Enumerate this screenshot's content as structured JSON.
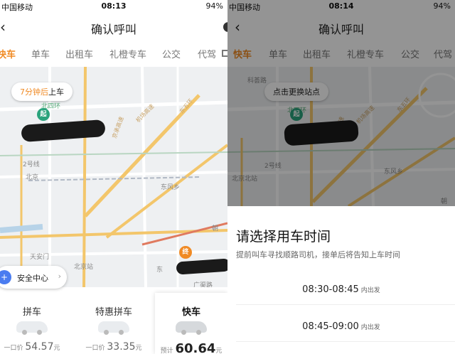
{
  "left": {
    "status": {
      "carrier": "中国移动",
      "time": "08:13",
      "battery": "94%"
    },
    "nav": {
      "title": "确认呼叫"
    },
    "tabs": [
      "快车",
      "单车",
      "出租车",
      "礼橙专车",
      "公交",
      "代驾"
    ],
    "pickup": {
      "minutes": "7分钟后",
      "suffix": "上车"
    },
    "pins": {
      "start": "起",
      "end": "终"
    },
    "map_labels": {
      "ring": "北四环",
      "east_ring": "东五环",
      "beijing": "北京",
      "dongfeng": "东风乡",
      "tiananmen": "天安门",
      "station": "北京站",
      "guangqu": "广渠路",
      "line2": "2号线",
      "dong": "东",
      "chao": "朝",
      "road": "机场高速",
      "road2": "京承高速"
    },
    "safety": {
      "label": "安全中心",
      "icon_text": "+"
    },
    "cards": [
      {
        "name": "拼车",
        "prefix": "一口价",
        "price": "54.57",
        "unit": "元"
      },
      {
        "name": "特惠拼车",
        "prefix": "一口价",
        "price": "33.35",
        "unit": "元"
      },
      {
        "name": "快车",
        "prefix": "预计",
        "price": "60.64",
        "unit": "元"
      }
    ]
  },
  "right": {
    "status": {
      "carrier": "中国移动",
      "time": "08:14",
      "battery": "94%"
    },
    "nav": {
      "title": "确认呼叫"
    },
    "tabs": [
      "快车",
      "单车",
      "出租车",
      "礼橙专车",
      "公交",
      "代驾"
    ],
    "change_stop": "点击更换站点",
    "pins": {
      "start": "起"
    },
    "map_labels": {
      "keyi": "科荟路",
      "ring": "北四环",
      "east_ring": "东五环",
      "station": "北京北站",
      "dongfeng": "东风乡",
      "line2": "2号线",
      "road": "机场高速",
      "road2": "京承高速",
      "chao": "朝"
    },
    "sheet": {
      "title": "请选择用车时间",
      "subtitle": "提前叫车寻找顺路司机，接单后将告知上车时间",
      "slots": [
        {
          "time": "08:30-08:45",
          "suffix": "内出发"
        },
        {
          "time": "08:45-09:00",
          "suffix": "内出发"
        }
      ]
    }
  },
  "colors": {
    "accent": "#f08a24",
    "start_pin": "#2aa37c",
    "safety": "#4a7cf0"
  }
}
